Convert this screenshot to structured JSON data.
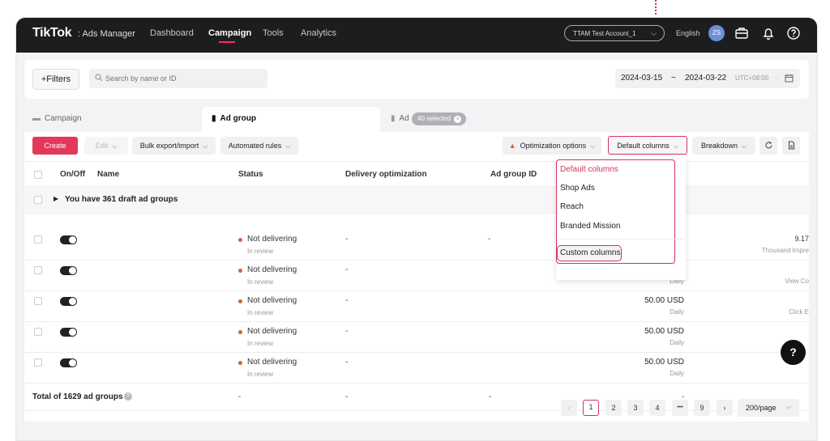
{
  "topbar": {
    "logo": "TikTok",
    "logo_sub": ": Ads Manager",
    "nav": [
      "Dashboard",
      "Campaign",
      "Tools",
      "Analytics"
    ],
    "account": "TTAM Test Account_1",
    "language": "English",
    "avatar_initials": "ZS"
  },
  "filterbar": {
    "filters_label": "+Filters",
    "search_placeholder": "Search by name or ID",
    "date_start": "2024-03-15",
    "date_sep": "~",
    "date_end": "2024-03-22",
    "timezone": "UTC+08:00"
  },
  "tabs": {
    "campaign": "Campaign",
    "ad_group": "Ad group",
    "ad": "Ad",
    "selected_badge": "40 selected"
  },
  "toolbar": {
    "create": "Create",
    "edit": "Edit",
    "bulk": "Bulk export/import",
    "rules": "Automated rules",
    "optimization": "Optimization options",
    "columns": "Default columns",
    "breakdown": "Breakdown"
  },
  "table": {
    "headers": [
      "On/Off",
      "Name",
      "Status",
      "Delivery optimization",
      "Ad group ID"
    ],
    "draft_text": "You have 361 draft ad groups",
    "rows": [
      {
        "status": "Not delivering",
        "sub": "In review",
        "delivery": "-",
        "id": "-",
        "budget": "",
        "budget_sub": "",
        "metric": "9.17",
        "metric_sub": "Thousand Impre"
      },
      {
        "status": "Not delivering",
        "sub": "In review",
        "delivery": "-",
        "id": "",
        "budget": "",
        "budget_sub": "Daily",
        "metric": "",
        "metric_sub": "View Co"
      },
      {
        "status": "Not delivering",
        "sub": "In review",
        "delivery": "-",
        "id": "",
        "budget": "50.00 USD",
        "budget_sub": "Daily",
        "metric": "",
        "metric_sub": "Click E"
      },
      {
        "status": "Not delivering",
        "sub": "In review",
        "delivery": "-",
        "id": "",
        "budget": "50.00 USD",
        "budget_sub": "Daily",
        "metric": "",
        "metric_sub": ""
      },
      {
        "status": "Not delivering",
        "sub": "In review",
        "delivery": "-",
        "id": "",
        "budget": "50.00 USD",
        "budget_sub": "Daily",
        "metric": "",
        "metric_sub": ""
      }
    ],
    "total_label": "Total of 1629 ad groups",
    "total_status": "-",
    "total_delivery": "-",
    "total_id": "-",
    "total_budget": "-"
  },
  "pagination": {
    "pages": [
      "1",
      "2",
      "3",
      "4",
      "•••",
      "9"
    ],
    "current": "1",
    "per_page": "200/page"
  },
  "columns_menu": {
    "items": [
      "Default columns",
      "Shop Ads",
      "Reach",
      "Branded Mission"
    ],
    "custom": "Custom columns"
  },
  "help_label": "?",
  "colors": {
    "accent": "#d7335a",
    "create": "#e2395a",
    "topbar": "#1d1d1f"
  }
}
